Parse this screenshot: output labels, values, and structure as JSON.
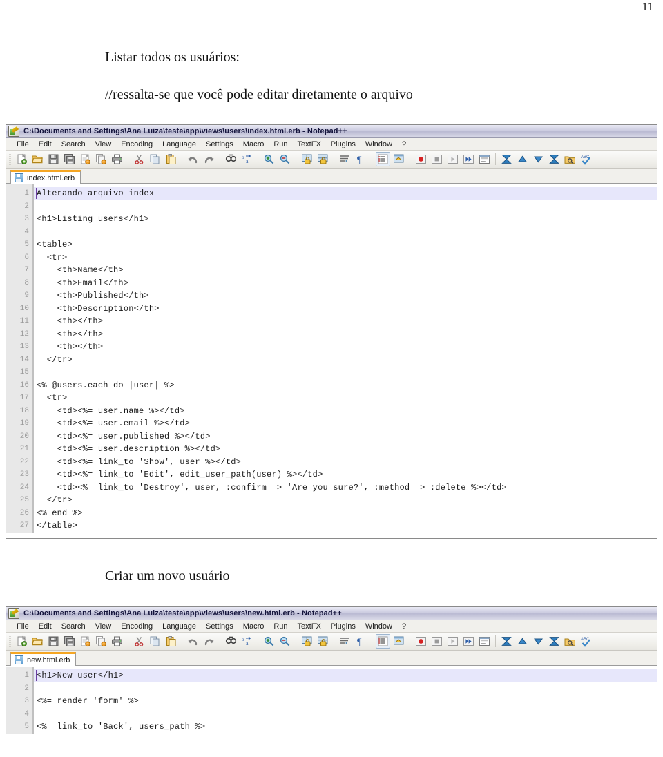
{
  "document": {
    "page_number": "11",
    "lines": [
      "Listar todos os usuários:",
      "//ressalta-se que você pode editar diretamente o arquivo",
      "Criar um novo usuário"
    ]
  },
  "menu_items": [
    "File",
    "Edit",
    "Search",
    "View",
    "Encoding",
    "Language",
    "Settings",
    "Macro",
    "Run",
    "TextFX",
    "Plugins",
    "Window",
    "?"
  ],
  "toolbar_icons": [
    "new-file-icon",
    "open-file-icon",
    "save-icon",
    "save-all-icon",
    "close-file-icon",
    "close-all-icon",
    "print-icon",
    "sep",
    "cut-icon",
    "copy-icon",
    "paste-icon",
    "sep",
    "undo-icon",
    "redo-icon",
    "sep",
    "find-icon",
    "replace-icon",
    "sep",
    "zoom-in-icon",
    "zoom-out-icon",
    "sep",
    "sync-vertical-scroll-icon",
    "sync-horizontal-scroll-icon",
    "sep",
    "word-wrap-icon",
    "show-all-chars-icon",
    "sep",
    "indent-guide-icon",
    "user-defined-dialog-icon",
    "sep",
    "record-macro-icon",
    "stop-recording-icon",
    "play-macro-icon",
    "run-macro-multiple-icon",
    "save-macro-icon",
    "sep",
    "collapse-all-icon",
    "fold-one-level-icon",
    "unfold-one-level-icon",
    "expand-all-icon",
    "document-map-icon",
    "spell-check-icon"
  ],
  "windows": [
    {
      "id": "index",
      "title": "C:\\Documents and Settings\\Ana Luiza\\teste\\app\\views\\users\\index.html.erb - Notepad++",
      "tab_label": "index.html.erb",
      "code_lines": [
        "Alterando arquivo index",
        "",
        "<h1>Listing users</h1>",
        "",
        "<table>",
        "  <tr>",
        "    <th>Name</th>",
        "    <th>Email</th>",
        "    <th>Published</th>",
        "    <th>Description</th>",
        "    <th></th>",
        "    <th></th>",
        "    <th></th>",
        "  </tr>",
        "",
        "<% @users.each do |user| %>",
        "  <tr>",
        "    <td><%= user.name %></td>",
        "    <td><%= user.email %></td>",
        "    <td><%= user.published %></td>",
        "    <td><%= user.description %></td>",
        "    <td><%= link_to 'Show', user %></td>",
        "    <td><%= link_to 'Edit', edit_user_path(user) %></td>",
        "    <td><%= link_to 'Destroy', user, :confirm => 'Are you sure?', :method => :delete %></td>",
        "  </tr>",
        "<% end %>",
        "</table>"
      ]
    },
    {
      "id": "new",
      "title": "C:\\Documents and Settings\\Ana Luiza\\teste\\app\\views\\users\\new.html.erb - Notepad++",
      "tab_label": "new.html.erb",
      "code_lines": [
        "<h1>New user</h1>",
        "",
        "<%= render 'form' %>",
        "",
        "<%= link_to 'Back', users_path %>"
      ]
    }
  ],
  "colors": {
    "titlebar_start": "#e9e9f4",
    "titlebar_end": "#b9b9d2",
    "tab_active_accent": "#f5a623",
    "current_line": "#e7e7fb",
    "gutter_bg": "#e8e8e8",
    "gutter_text": "#9b9b9b"
  }
}
